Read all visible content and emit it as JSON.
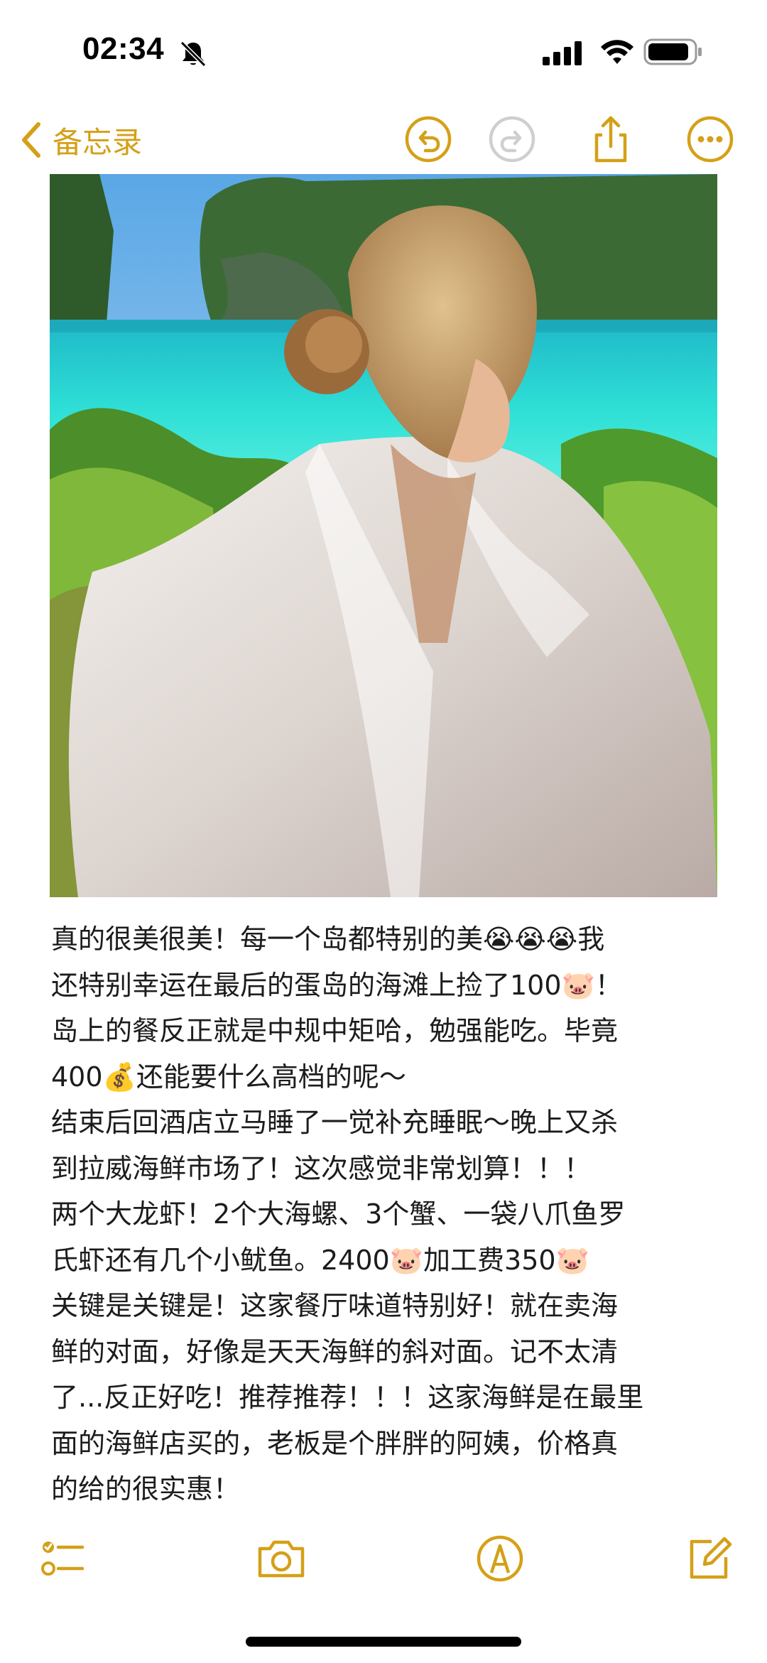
{
  "status_bar": {
    "time": "02:34",
    "icons": [
      "bell-slash-icon",
      "cellular-signal-icon",
      "wifi-icon",
      "battery-icon"
    ]
  },
  "nav": {
    "back_label": "备忘录",
    "icons": [
      "undo-icon",
      "redo-icon",
      "share-icon",
      "more-icon"
    ]
  },
  "photo": {
    "subject": "photo-woman-on-beach"
  },
  "note": {
    "lines": [
      "真的很美很美！每一个岛都特别的美😭😭😭我",
      "还特别幸运在最后的蛋岛的海滩上捡了100🐷！",
      "岛上的餐反正就是中规中矩哈，勉强能吃。毕竟",
      "400💰还能要什么高档的呢～",
      "结束后回酒店立马睡了一觉补充睡眠～晚上又杀",
      "到拉威海鲜市场了！这次感觉非常划算！！！",
      "两个大龙虾！2个大海螺、3个蟹、一袋八爪鱼罗",
      "氏虾还有几个小鱿鱼。2400🐷加工费350🐷",
      "关键是关键是！这家餐厅味道特别好！就在卖海",
      "鲜的对面，好像是天天海鲜的斜对面。记不太清",
      "了...反正好吃！推荐推荐！！！这家海鲜是在最里",
      "面的海鲜店买的，老板是个胖胖的阿姨，价格真",
      "的给的很实惠！"
    ]
  },
  "toolbar": {
    "icons": [
      "checklist-icon",
      "camera-icon",
      "markup-icon",
      "compose-icon"
    ]
  },
  "colors": {
    "accent": "#d4a017",
    "text": "#1c1c1e",
    "background": "#ffffff",
    "disabled": "#cfcfcf"
  }
}
